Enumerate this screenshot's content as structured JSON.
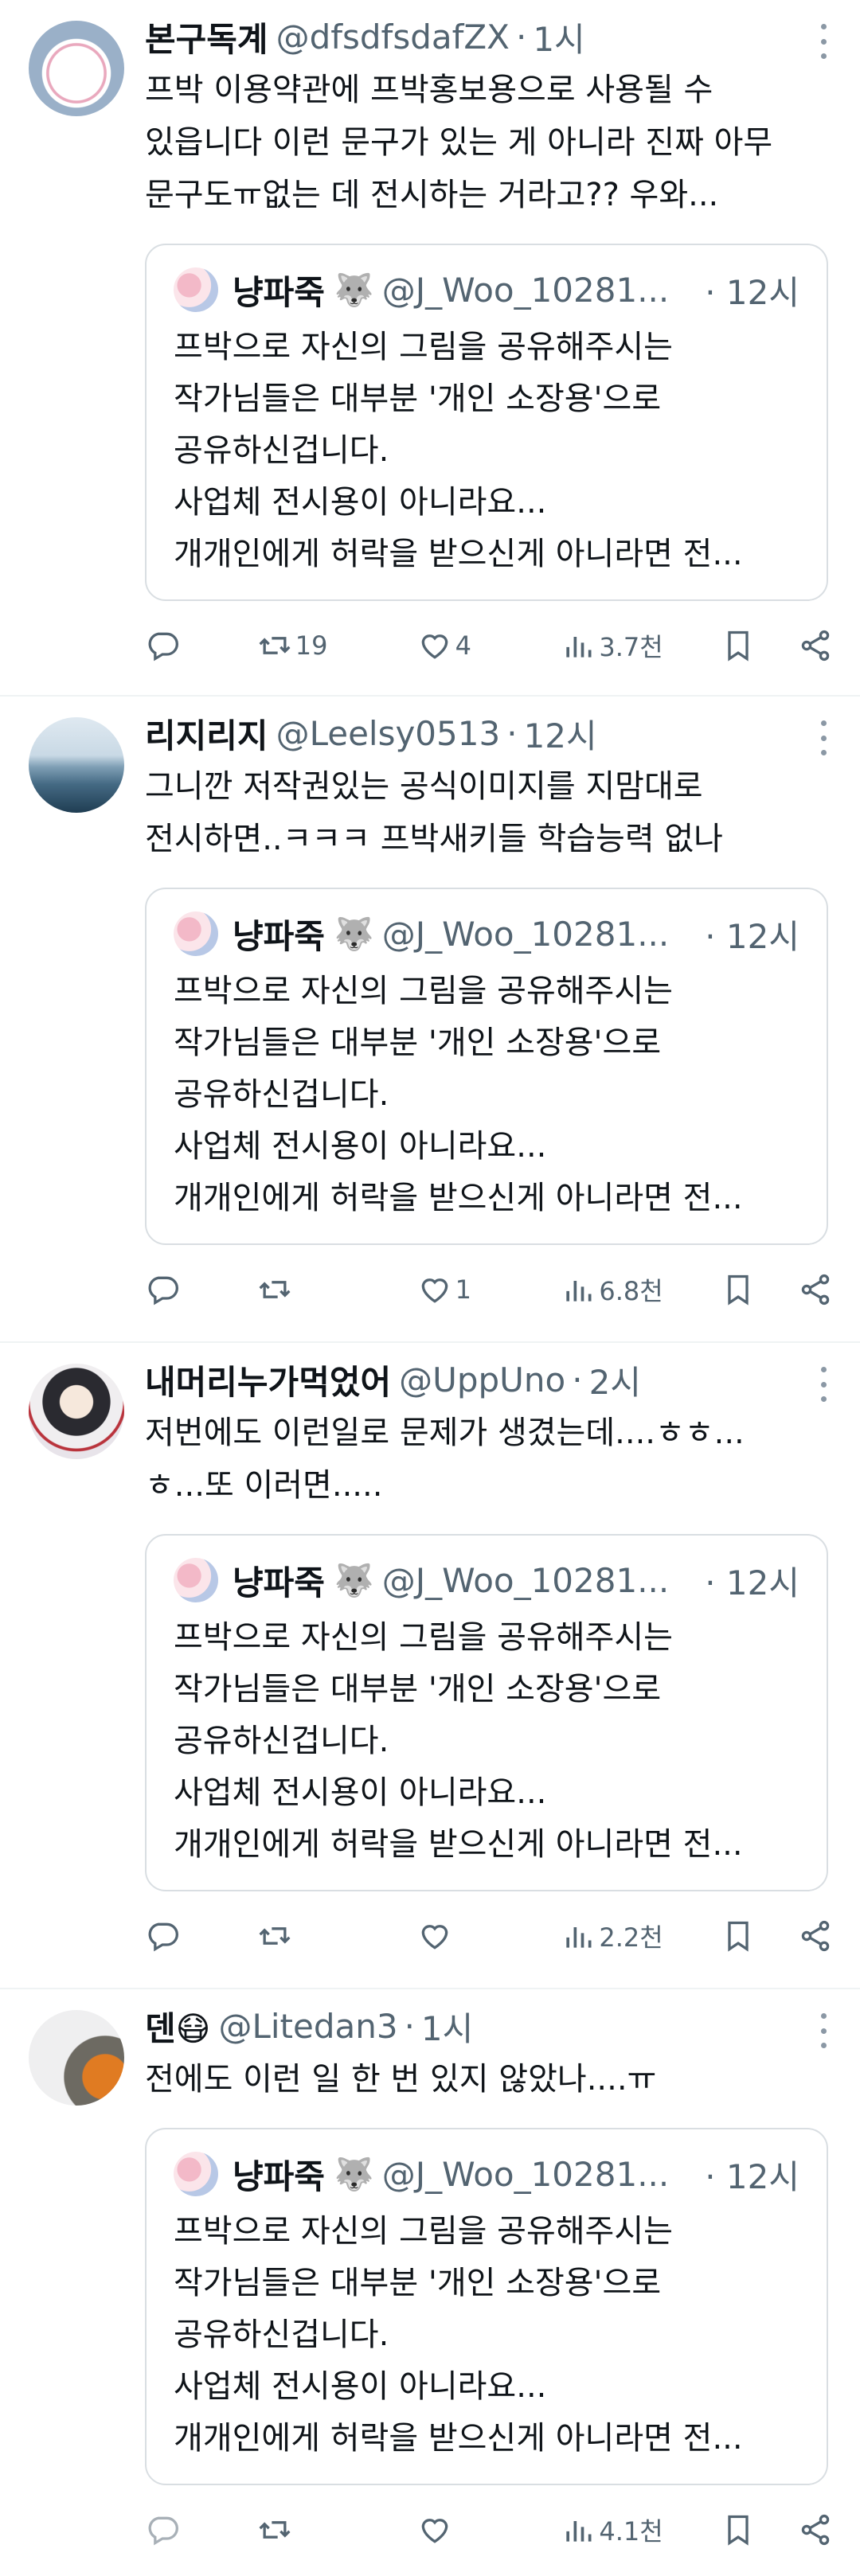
{
  "posts": [
    {
      "name": "본구독계",
      "handle": "@dfsdfsdafZX",
      "time": "1시",
      "text": "프박 이용약관에 프박홍보용으로 사용될 수\n있읍니다 이런 문구가 있는 게 아니라 진짜 아무\n문구도ㅠ없는 데 전시하는 거라고?? 우와...",
      "quote": {
        "name": "냥파죽",
        "emoji": "🐺",
        "handle": "@J_Woo_10281...",
        "time": "12시",
        "text": "프박으로 자신의 그림을 공유해주시는\n작가님들은 대부분 '개인 소장용'으로\n공유하신겁니다.\n사업체 전시용이 아니라요...\n개개인에게 허락을 받으신게 아니라면 전..."
      },
      "stats": {
        "reply": "",
        "retweet": "19",
        "like": "4",
        "views": "3.7천"
      }
    },
    {
      "name": "리지리지",
      "handle": "@Leelsy0513",
      "time": "12시",
      "text": "그니깐 저작권있는 공식이미지를 지맘대로\n전시하면..ㅋㅋㅋ 프박새키들 학습능력 없나",
      "quote": {
        "name": "냥파죽",
        "emoji": "🐺",
        "handle": "@J_Woo_10281...",
        "time": "12시",
        "text": "프박으로 자신의 그림을 공유해주시는\n작가님들은 대부분 '개인 소장용'으로\n공유하신겁니다.\n사업체 전시용이 아니라요...\n개개인에게 허락을 받으신게 아니라면 전..."
      },
      "stats": {
        "reply": "",
        "retweet": "",
        "like": "1",
        "views": "6.8천"
      }
    },
    {
      "name": "내머리누가먹었어",
      "handle": "@UppUno",
      "time": "2시",
      "text": "저번에도 이런일로 문제가 생겼는데....ㅎㅎ...\nㅎ...또 이러면.....",
      "quote": {
        "name": "냥파죽",
        "emoji": "🐺",
        "handle": "@J_Woo_10281...",
        "time": "12시",
        "text": "프박으로 자신의 그림을 공유해주시는\n작가님들은 대부분 '개인 소장용'으로\n공유하신겁니다.\n사업체 전시용이 아니라요...\n개개인에게 허락을 받으신게 아니라면 전..."
      },
      "stats": {
        "reply": "",
        "retweet": "",
        "like": "",
        "views": "2.2천"
      }
    },
    {
      "name": "덴😷",
      "handle": "@Litedan3",
      "time": "1시",
      "text": "전에도 이런 일 한 번 있지 않았나....ㅠ",
      "quote": {
        "name": "냥파죽",
        "emoji": "🐺",
        "handle": "@J_Woo_10281...",
        "time": "12시",
        "text": "프박으로 자신의 그림을 공유해주시는\n작가님들은 대부분 '개인 소장용'으로\n공유하신겁니다.\n사업체 전시용이 아니라요...\n개개인에게 허락을 받으신게 아니라면 전..."
      },
      "stats": {
        "reply": "",
        "retweet": "",
        "like": "",
        "views": "4.1천"
      }
    }
  ],
  "icons": {
    "reply": "reply-icon",
    "retweet": "retweet-icon",
    "like": "heart-icon",
    "views": "views-icon",
    "bookmark": "bookmark-icon",
    "share": "share-icon",
    "more": "more-icon"
  },
  "colors": {
    "text": "#0f1419",
    "muted": "#536471",
    "border": "#eff3f4"
  }
}
